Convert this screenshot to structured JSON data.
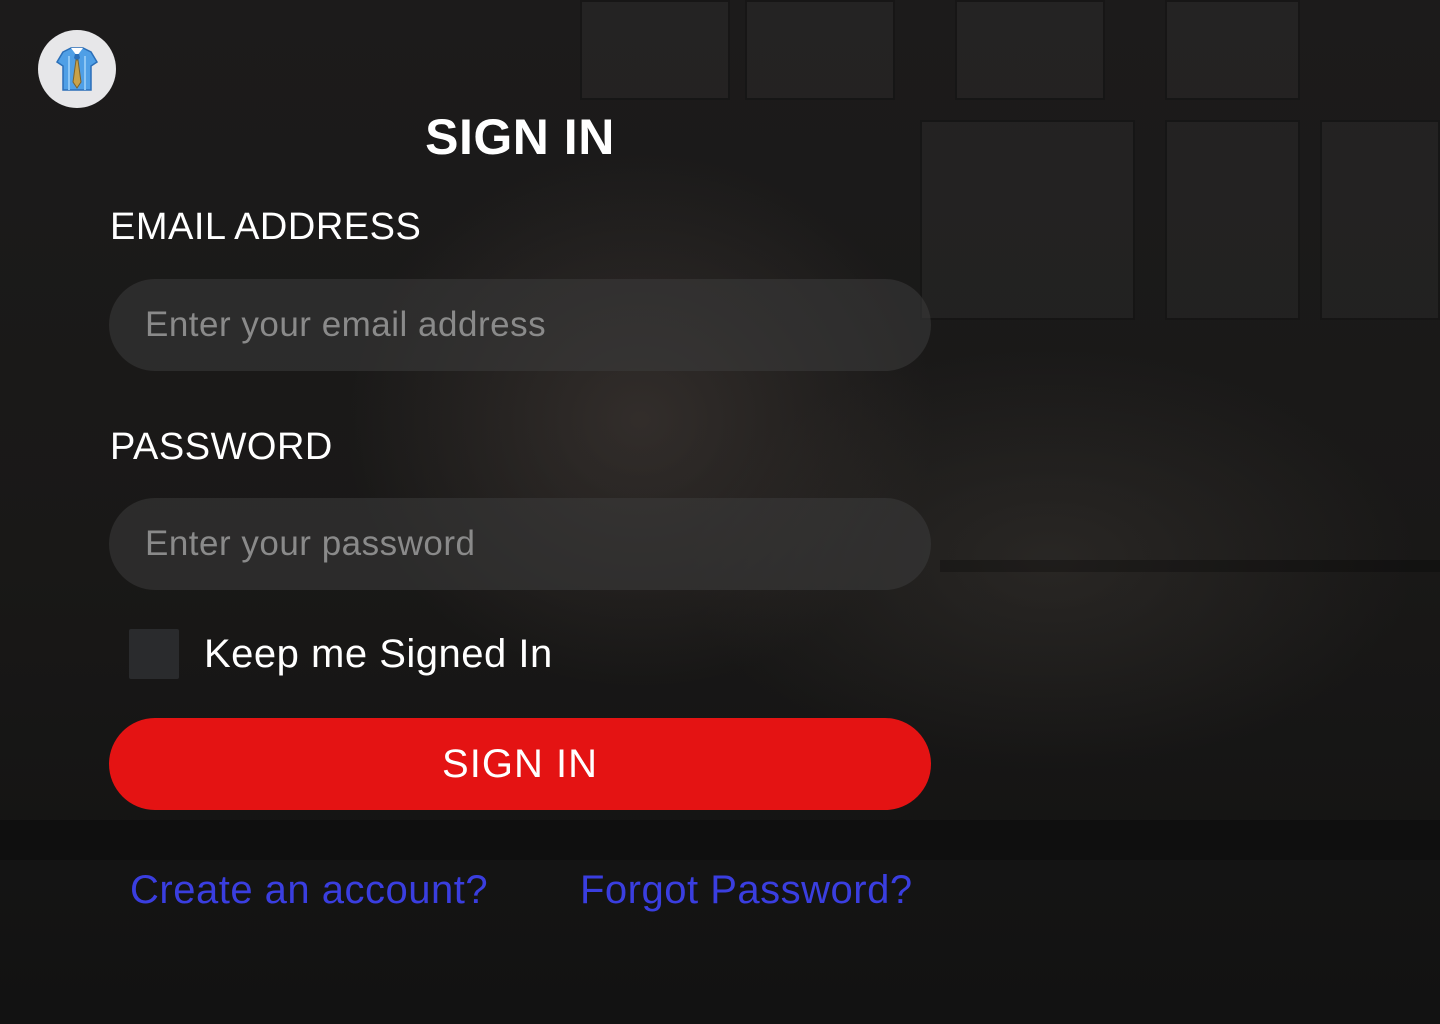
{
  "logo": {
    "icon": "shirt-tie-icon"
  },
  "form": {
    "title": "SIGN IN",
    "email_label": "EMAIL ADDRESS",
    "email_placeholder": "Enter your email address",
    "email_value": "",
    "password_label": "PASSWORD",
    "password_placeholder": "Enter your password",
    "password_value": "",
    "keep_signed_in_label": "Keep me Signed In",
    "keep_signed_in_checked": false,
    "submit_label": "SIGN IN"
  },
  "links": {
    "create_account": "Create an account?",
    "forgot_password": "Forgot Password?"
  },
  "colors": {
    "accent": "#e41313",
    "link": "#3a3ee0",
    "input_bg": "#333333",
    "text": "#ffffff"
  }
}
